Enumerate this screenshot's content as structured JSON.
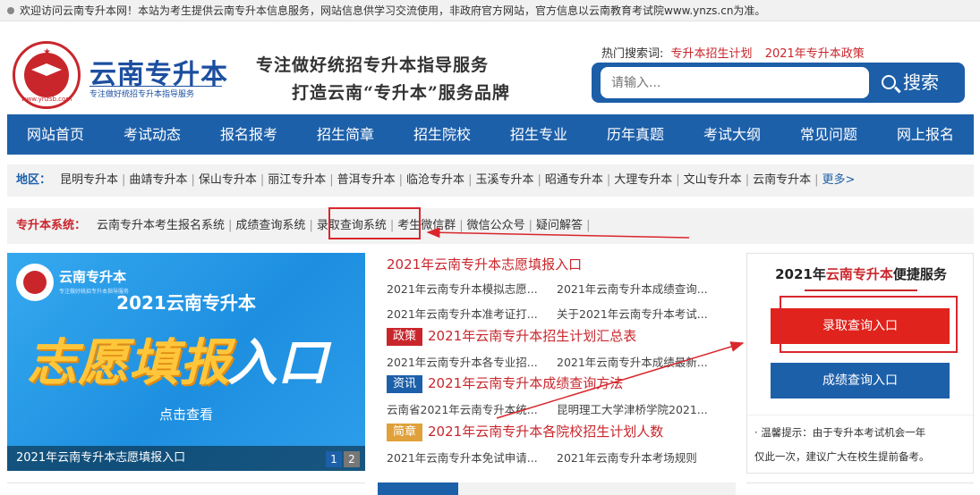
{
  "topbar": {
    "notice": "欢迎访问云南专升本网！本站为考生提供云南专升本信息服务，网站信息供学习交流使用，非政府官方网站，官方信息以云南教育考试院www.ynzs.cn为准。"
  },
  "logo": {
    "title": "云南专升本",
    "subtitle": "专注做好统招专升本指导服务",
    "url": "www.ynzsb.com"
  },
  "slogan": {
    "line1": "专注做好统招专升本指导服务",
    "line2": "打造云南“专升本”服务品牌"
  },
  "hot_search": {
    "label": "热门搜索词:",
    "links": [
      "专升本招生计划",
      "2021年专升本政策"
    ]
  },
  "search": {
    "placeholder": "请输入...",
    "button": "搜索"
  },
  "nav": {
    "items": [
      "网站首页",
      "考试动态",
      "报名报考",
      "招生简章",
      "招生院校",
      "招生专业",
      "历年真题",
      "考试大纲",
      "常见问题",
      "网上报名"
    ]
  },
  "region": {
    "label": "地区：",
    "links": [
      "昆明专升本",
      "曲靖专升本",
      "保山专升本",
      "丽江专升本",
      "普洱专升本",
      "临沧专升本",
      "玉溪专升本",
      "昭通专升本",
      "大理专升本",
      "文山专升本",
      "云南专升本"
    ],
    "more": "更多>"
  },
  "system": {
    "label": "专升本系统：",
    "links": [
      "云南专升本考生报名系统",
      "成绩查询系统",
      "录取查询系统",
      "考生微信群",
      "微信公众号",
      "疑问解答"
    ]
  },
  "banner": {
    "brand": "云南专升本",
    "brand_sub": "专注做好统招专升本指导服务",
    "year_title": "2021云南专升本",
    "big_left": "志愿填报",
    "big_right": "入口",
    "action": "点击查看",
    "caption": "2021年云南专升本志愿填报入口",
    "pages": [
      "1",
      "2"
    ]
  },
  "news": {
    "blocks": [
      {
        "tag": "",
        "headline": "2021年云南专升本志愿填报入口",
        "items": [
          [
            "2021年云南专升本模拟志愿...",
            "2021年云南专升本成绩查询..."
          ],
          [
            "2021年云南专升本准考证打...",
            "关于2021年云南专升本考试..."
          ]
        ]
      },
      {
        "tag": "政策",
        "headline": "2021年云南专升本招生计划汇总表",
        "items": [
          [
            "2021年云南专升本各专业招...",
            "2021年云南专升本成绩最新..."
          ]
        ]
      },
      {
        "tag": "资讯",
        "headline": "2021年云南专升本成绩查询方法",
        "items": [
          [
            "云南省2021年云南专升本统...",
            "昆明理工大学津桥学院2021..."
          ]
        ]
      },
      {
        "tag": "简章",
        "headline": "2021年云南专升本各院校招生计划人数",
        "items": [
          [
            "2021年云南专升本免试申请...",
            "2021年云南专升本考场规则"
          ]
        ]
      }
    ]
  },
  "service": {
    "title_year": "2021年",
    "title_red": "云南专升本",
    "title_tail": "便捷服务",
    "btn_admission": "录取查询入口",
    "btn_score": "成绩查询入口",
    "tip1": "· 温馨提示：由于专升本考试机会一年",
    "tip2": "仅此一次，建议广大在校生提前备考。"
  },
  "colors": {
    "brand_blue": "#1d60aa",
    "accent_red": "#c9262c",
    "tag_policy": "#c9262c",
    "tag_info": "#1d60aa",
    "tag_guide": "#e0a03a"
  }
}
